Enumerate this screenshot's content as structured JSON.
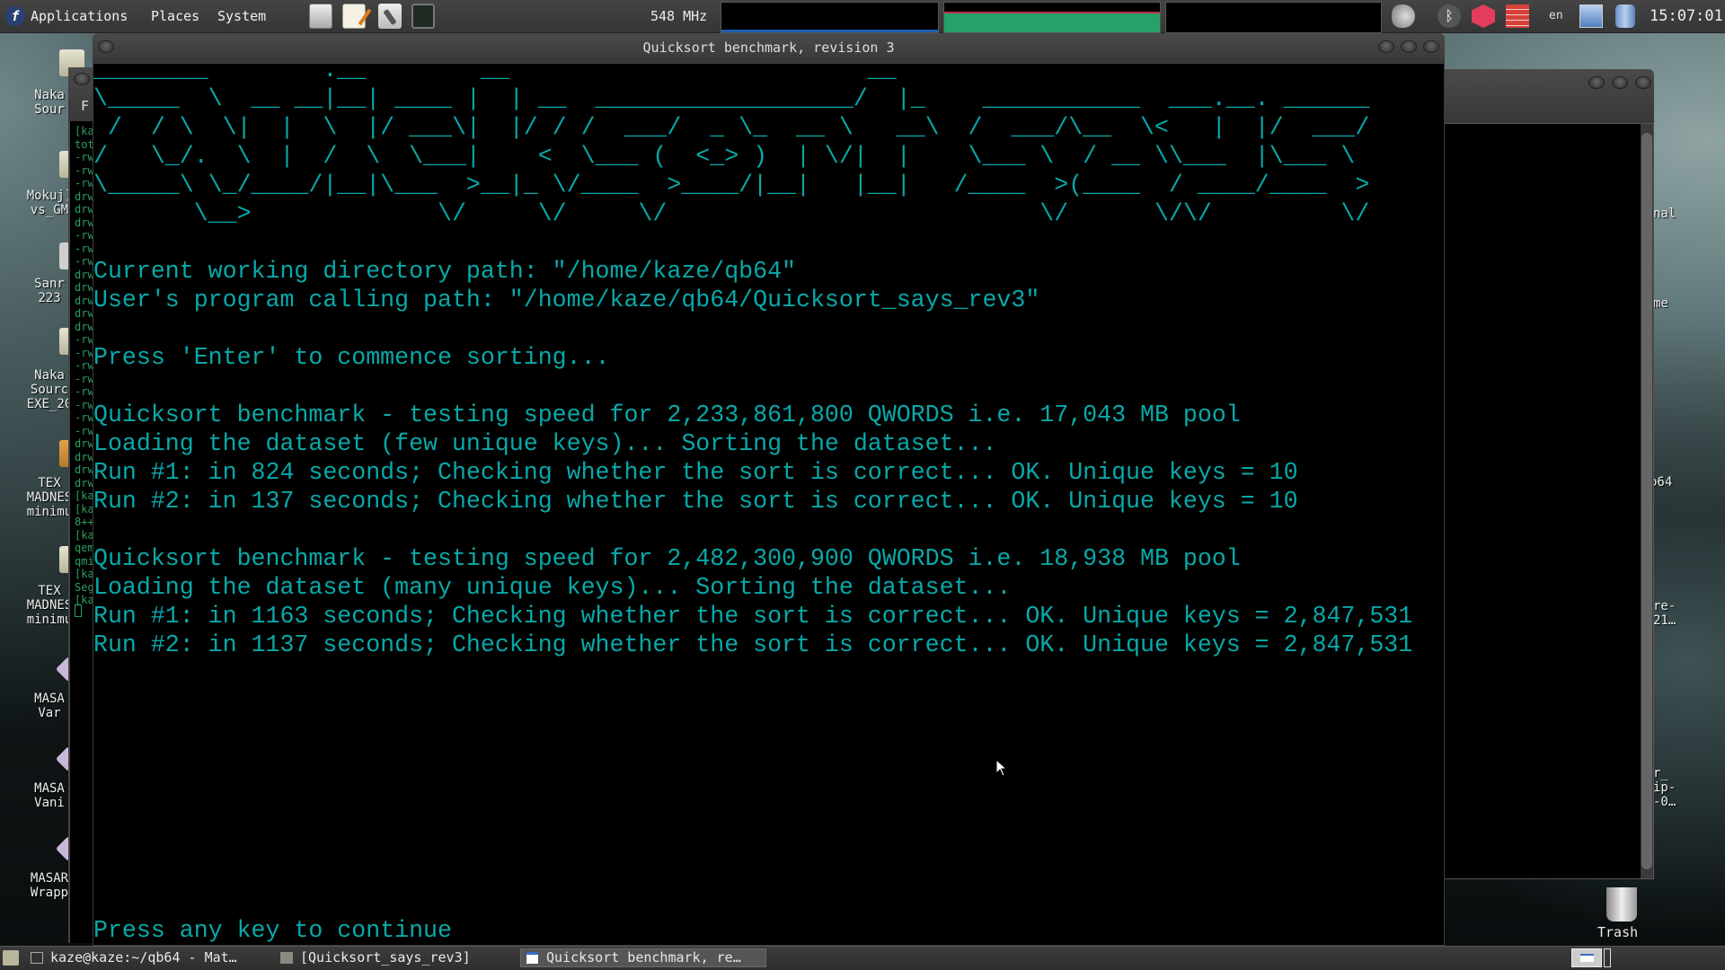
{
  "top_panel": {
    "menus": [
      "Applications",
      "Places",
      "System"
    ],
    "launchers": [
      "file-cabinet-icon",
      "text-editor-icon",
      "system-tools-icon",
      "terminal-icon"
    ],
    "cpu_freq": "548 MHz",
    "keyboard_layout": "en",
    "clock": "15:07:01",
    "graph_colors": {
      "cpu": "#1e5fb4",
      "memory": "#26a269",
      "memory_line": "#c0304a"
    }
  },
  "terminal": {
    "title": "Quicksort benchmark, revision 3",
    "banner_text": "Quicksort says",
    "banner_art": [
      "________        .__        __                         __",
      "\\_____  \\  __ __|__| ____ |  | __  __________________/  |_    ___________  ___.__. ______",
      " /  / \\  \\|  |  \\  |/ ___\\|  |/ / /  ___/  _ \\_  __ \\   __\\  /  ___/\\__  \\<   |  |/  ___/",
      "/   \\_/.  \\  |  /  \\  \\___|    <  \\___ (  <_> )  | \\/|  |    \\___ \\  / __ \\\\___  |\\___ \\",
      "\\_____\\ \\_/____/|__|\\___  >__|_ \\/____  >____/|__|   |__|   /____  >(____  / ____/____  >",
      "       \\__>             \\/     \\/     \\/                          \\/      \\/\\/         \\/"
    ],
    "lines": [
      "Current working directory path: \"/home/kaze/qb64\"",
      "User's program calling path: \"/home/kaze/qb64/Quicksort_says_rev3\"",
      "",
      "Press 'Enter' to commence sorting...",
      "",
      "Quicksort benchmark - testing speed for 2,233,861,800 QWORDS i.e. 17,043 MB pool",
      "Loading the dataset (few unique keys)... Sorting the dataset...",
      "Run #1: in 824 seconds; Checking whether the sort is correct... OK. Unique keys = 10",
      "Run #2: in 137 seconds; Checking whether the sort is correct... OK. Unique keys = 10",
      "",
      "Quicksort benchmark - testing speed for 2,482,300,900 QWORDS i.e. 18,938 MB pool",
      "Loading the dataset (many unique keys)... Sorting the dataset...",
      "Run #1: in 1163 seconds; Checking whether the sort is correct... OK. Unique keys = 2,847,531",
      "Run #2: in 1137 seconds; Checking whether the sort is correct... OK. Unique keys = 2,847,531"
    ],
    "prompt": "Press any key to continue",
    "text_color": "#0aa8a8"
  },
  "background_terminal": {
    "title_fragment": "F",
    "lines": [
      "[ka",
      "tot",
      "-rw",
      "-rw",
      "-rw",
      "drw",
      "drw",
      "drw",
      "-rw",
      "-rw",
      "-rw",
      "drw",
      "drw",
      "drw",
      "drw",
      "drw",
      "-rw",
      "-rw",
      "-rw",
      "-rw",
      "-rw",
      "-rw",
      "-rw",
      "-rw",
      "drw",
      "drw",
      "drw",
      "drw",
      "[ka",
      "[ka",
      "8++",
      "[ka",
      "qem",
      "qmi",
      "[ka",
      "Seg",
      "[ka"
    ]
  },
  "desktop_icons_left": [
    "Naka\nSour",
    "Mokuj]\nvs_GM",
    "Sanr\n223",
    "Naka\nSourc\nEXE_20",
    "TEX\nMADNES\nminimu",
    "TEX\nMADNES\nminimu",
    "MASA\nVar",
    "MASA\nVani",
    "MASAR\nWrapp"
  ],
  "desktop_labels_right": [
    "nal",
    "me",
    "b64",
    "re-\n21…",
    "r_\nip-\n-0…"
  ],
  "trash_label": "Trash",
  "taskbar": {
    "tasks": [
      {
        "label": "kaze@kaze:~/qb64 - Mat…",
        "icon": "terminal-icon",
        "active": false
      },
      {
        "label": "[Quicksort_says_rev3]",
        "icon": "folder-icon",
        "active": false
      },
      {
        "label": "Quicksort benchmark, re…",
        "icon": "window-icon",
        "active": true
      }
    ]
  }
}
